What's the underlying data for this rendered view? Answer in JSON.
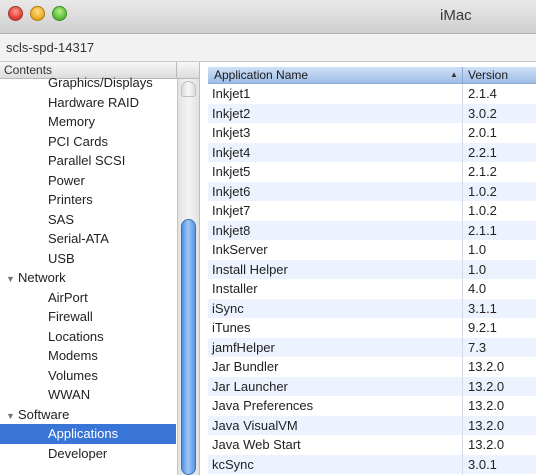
{
  "window": {
    "title": "iMac",
    "host": "scls-spd-14317"
  },
  "sidebar": {
    "header": "Contents",
    "items": [
      {
        "label": "Graphics/Displays",
        "type": "child"
      },
      {
        "label": "Hardware RAID",
        "type": "child"
      },
      {
        "label": "Memory",
        "type": "child"
      },
      {
        "label": "PCI Cards",
        "type": "child"
      },
      {
        "label": "Parallel SCSI",
        "type": "child"
      },
      {
        "label": "Power",
        "type": "child"
      },
      {
        "label": "Printers",
        "type": "child"
      },
      {
        "label": "SAS",
        "type": "child"
      },
      {
        "label": "Serial-ATA",
        "type": "child"
      },
      {
        "label": "USB",
        "type": "child"
      },
      {
        "label": "Network",
        "type": "group"
      },
      {
        "label": "AirPort",
        "type": "child"
      },
      {
        "label": "Firewall",
        "type": "child"
      },
      {
        "label": "Locations",
        "type": "child"
      },
      {
        "label": "Modems",
        "type": "child"
      },
      {
        "label": "Volumes",
        "type": "child"
      },
      {
        "label": "WWAN",
        "type": "child"
      },
      {
        "label": "Software",
        "type": "group"
      },
      {
        "label": "Applications",
        "type": "child",
        "selected": true
      },
      {
        "label": "Developer",
        "type": "child"
      }
    ]
  },
  "table": {
    "columns": [
      "Application Name",
      "Version"
    ],
    "sort_icon": "triangle-up-icon",
    "rows": [
      [
        "Inkjet1",
        "2.1.4"
      ],
      [
        "Inkjet2",
        "3.0.2"
      ],
      [
        "Inkjet3",
        "2.0.1"
      ],
      [
        "Inkjet4",
        "2.2.1"
      ],
      [
        "Inkjet5",
        "2.1.2"
      ],
      [
        "Inkjet6",
        "1.0.2"
      ],
      [
        "Inkjet7",
        "1.0.2"
      ],
      [
        "Inkjet8",
        "2.1.1"
      ],
      [
        "InkServer",
        "1.0"
      ],
      [
        "Install Helper",
        "1.0"
      ],
      [
        "Installer",
        "4.0"
      ],
      [
        "iSync",
        "3.1.1"
      ],
      [
        "iTunes",
        "9.2.1"
      ],
      [
        "jamfHelper",
        "7.3"
      ],
      [
        "Jar Bundler",
        "13.2.0"
      ],
      [
        "Jar Launcher",
        "13.2.0"
      ],
      [
        "Java Preferences",
        "13.2.0"
      ],
      [
        "Java VisualVM",
        "13.2.0"
      ],
      [
        "Java Web Start",
        "13.2.0"
      ],
      [
        "kcSync",
        "3.0.1"
      ]
    ]
  },
  "colors": {
    "selection": "#3875d7",
    "header_blue": "#9fbde6",
    "row_alt": "#edf3fe"
  }
}
